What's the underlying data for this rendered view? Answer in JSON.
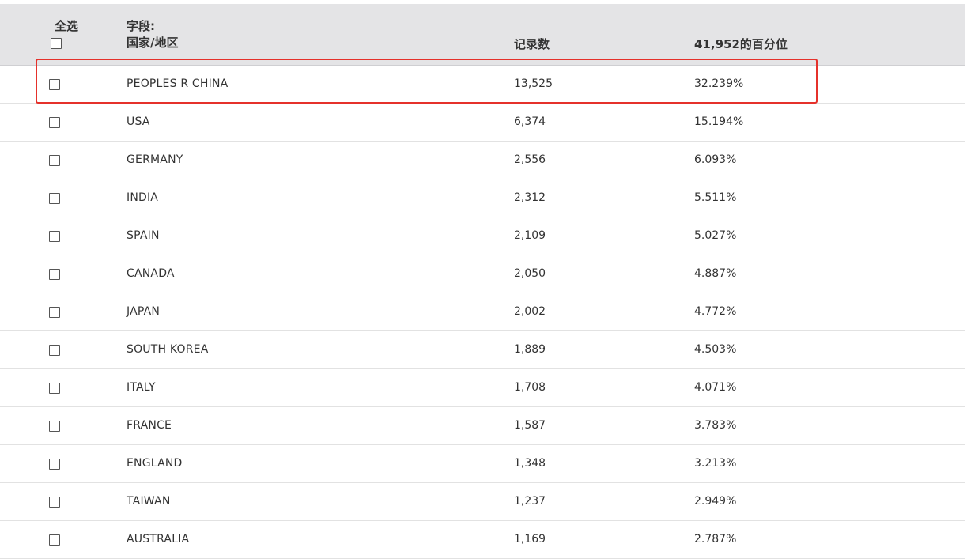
{
  "header": {
    "select_all_label": "全选",
    "field_prefix": "字段:",
    "field_name": "国家/地区",
    "count_label": "记录数",
    "percent_label": "41,952的百分位"
  },
  "highlight": {
    "color": "#e5312b",
    "row_index": 0
  },
  "rows": [
    {
      "name": "PEOPLES R CHINA",
      "count": "13,525",
      "percent": "32.239%"
    },
    {
      "name": "USA",
      "count": "6,374",
      "percent": "15.194%"
    },
    {
      "name": "GERMANY",
      "count": "2,556",
      "percent": "6.093%"
    },
    {
      "name": "INDIA",
      "count": "2,312",
      "percent": "5.511%"
    },
    {
      "name": "SPAIN",
      "count": "2,109",
      "percent": "5.027%"
    },
    {
      "name": "CANADA",
      "count": "2,050",
      "percent": "4.887%"
    },
    {
      "name": "JAPAN",
      "count": "2,002",
      "percent": "4.772%"
    },
    {
      "name": "SOUTH KOREA",
      "count": "1,889",
      "percent": "4.503%"
    },
    {
      "name": "ITALY",
      "count": "1,708",
      "percent": "4.071%"
    },
    {
      "name": "FRANCE",
      "count": "1,587",
      "percent": "3.783%"
    },
    {
      "name": "ENGLAND",
      "count": "1,348",
      "percent": "3.213%"
    },
    {
      "name": "TAIWAN",
      "count": "1,237",
      "percent": "2.949%"
    },
    {
      "name": "AUSTRALIA",
      "count": "1,169",
      "percent": "2.787%"
    }
  ]
}
